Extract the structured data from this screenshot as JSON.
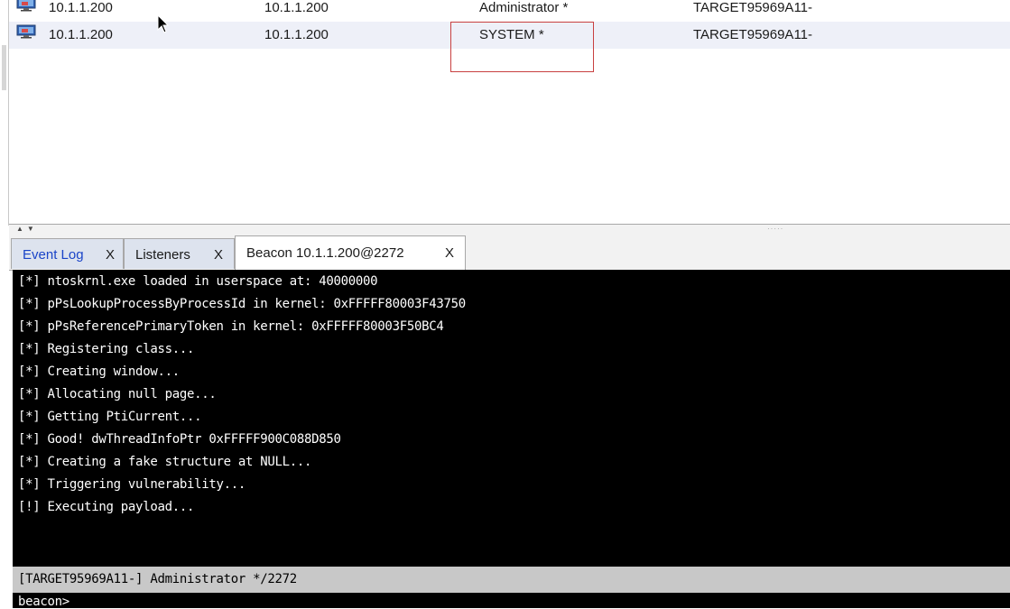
{
  "sessions": {
    "rows": [
      {
        "external": "10.1.1.200",
        "internal": "10.1.1.200",
        "user": "Administrator *",
        "computer": "TARGET95969A11-"
      },
      {
        "external": "10.1.1.200",
        "internal": "10.1.1.200",
        "user": "SYSTEM *",
        "computer": "TARGET95969A11-"
      }
    ]
  },
  "tabs": [
    {
      "label": "Event Log",
      "close": "X"
    },
    {
      "label": "Listeners",
      "close": "X"
    },
    {
      "label": "Beacon 10.1.1.200@2272",
      "close": "X"
    }
  ],
  "console": {
    "lines": [
      "[*] ntoskrnl.exe loaded in userspace at: 40000000",
      "[*] pPsLookupProcessByProcessId in kernel: 0xFFFFF80003F43750",
      "[*] pPsReferencePrimaryToken in kernel: 0xFFFFF80003F50BC4",
      "[*] Registering class...",
      "[*] Creating window...",
      "[*] Allocating null page...",
      "[*] Getting PtiCurrent...",
      "[*] Good! dwThreadInfoPtr 0xFFFFF900C088D850",
      "[*] Creating a fake structure at NULL...",
      "[*] Triggering vulnerability...",
      "[!] Executing payload..."
    ],
    "status": "[TARGET95969A11-] Administrator */2272",
    "prompt": "beacon>"
  },
  "icons": {
    "session": "monitor-icon",
    "cursor": "mouse-cursor-icon"
  },
  "colors": {
    "console_bg": "#000000",
    "active_tab_text": "#1a44c8",
    "selection_border": "#c84040"
  }
}
